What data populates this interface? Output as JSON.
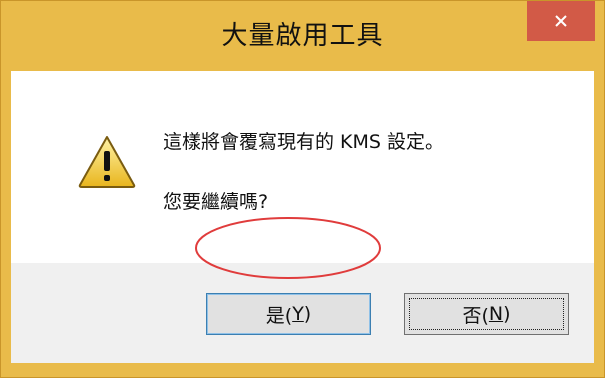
{
  "window": {
    "title": "大量啟用工具",
    "close_label": "×"
  },
  "icon": {
    "name": "warning-icon"
  },
  "message": {
    "line1": "這樣將會覆寫現有的 KMS 設定。",
    "line2": "您要繼續嗎?"
  },
  "buttons": {
    "yes_prefix": "是(",
    "yes_key": "Y",
    "yes_suffix": ")",
    "no_prefix": "否(",
    "no_key": "N",
    "no_suffix": ")"
  },
  "colors": {
    "title_bar": "#e9bb4a",
    "close_button": "#d25a47",
    "annotation_circle": "#e03c3c"
  }
}
